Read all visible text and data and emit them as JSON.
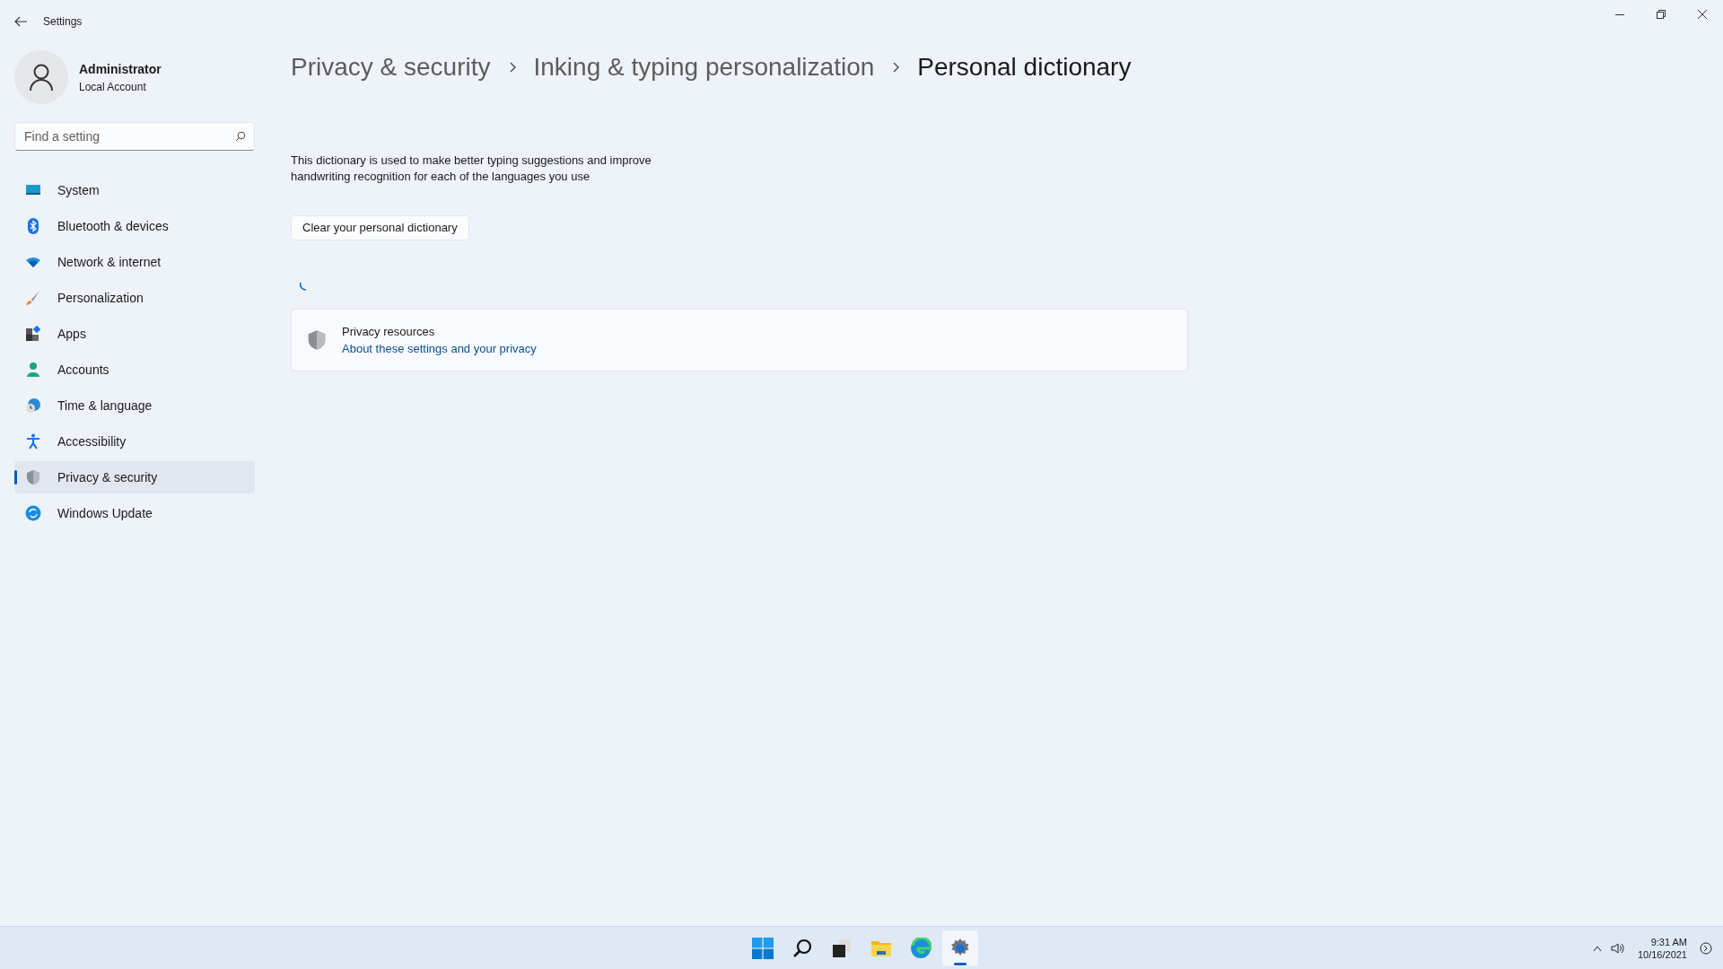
{
  "window": {
    "title": "Settings"
  },
  "account": {
    "name": "Administrator",
    "type": "Local Account"
  },
  "search": {
    "placeholder": "Find a setting"
  },
  "nav": [
    {
      "label": "System",
      "kind": "system",
      "selected": false
    },
    {
      "label": "Bluetooth & devices",
      "kind": "bluetooth",
      "selected": false
    },
    {
      "label": "Network & internet",
      "kind": "network",
      "selected": false
    },
    {
      "label": "Personalization",
      "kind": "brush",
      "selected": false
    },
    {
      "label": "Apps",
      "kind": "apps",
      "selected": false
    },
    {
      "label": "Accounts",
      "kind": "accounts",
      "selected": false
    },
    {
      "label": "Time & language",
      "kind": "time",
      "selected": false
    },
    {
      "label": "Accessibility",
      "kind": "accessibility",
      "selected": false
    },
    {
      "label": "Privacy & security",
      "kind": "privacy",
      "selected": true
    },
    {
      "label": "Windows Update",
      "kind": "update",
      "selected": false
    }
  ],
  "breadcrumb": [
    "Privacy & security",
    "Inking & typing personalization",
    "Personal dictionary"
  ],
  "description": "This dictionary is used to make better typing suggestions and improve handwriting recognition for each of the languages you use",
  "clear_button": "Clear your personal dictionary",
  "privacy_card": {
    "title": "Privacy resources",
    "link": "About these settings and your privacy"
  },
  "taskbar": {
    "apps": [
      {
        "kind": "start",
        "selected": false
      },
      {
        "kind": "search",
        "selected": false
      },
      {
        "kind": "taskview",
        "selected": false
      },
      {
        "kind": "explorer",
        "selected": false
      },
      {
        "kind": "browser",
        "selected": false
      },
      {
        "kind": "settings",
        "selected": true
      }
    ],
    "time": "9:31 AM",
    "date": "10/16/2021"
  }
}
